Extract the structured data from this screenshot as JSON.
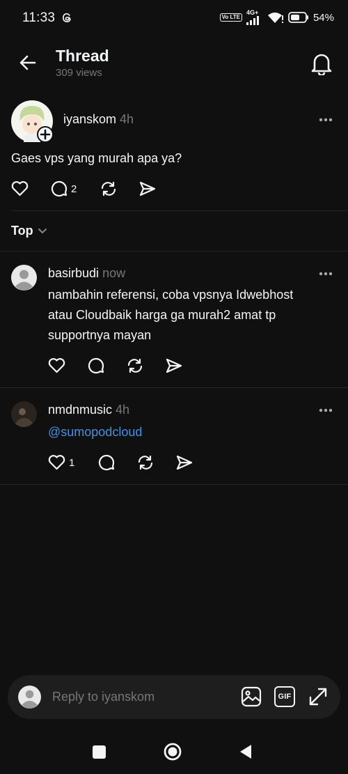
{
  "status_bar": {
    "time": "11:33",
    "network": "4G+",
    "volte": "Vo LTE",
    "battery": "54%"
  },
  "header": {
    "title": "Thread",
    "views": "309 views"
  },
  "post": {
    "username": "iyanskom",
    "time": "4h",
    "text": "Gaes vps yang murah apa ya?",
    "reply_count": "2"
  },
  "sort": {
    "label": "Top"
  },
  "replies": [
    {
      "username": "basirbudi",
      "time": "now",
      "lines": [
        "nambahin referensi, coba vpsnya Idwebhost",
        "atau Cloudbaik harga ga murah2 amat tp",
        "supportnya mayan"
      ]
    },
    {
      "username": "nmdnmusic",
      "time": "4h",
      "text": "@sumopodcloud",
      "like_count": "1"
    }
  ],
  "composer": {
    "placeholder": "Reply to iyanskom",
    "gif_label": "GIF"
  },
  "colors": {
    "background": "#101010",
    "text": "#f3f5f7",
    "muted": "#777777",
    "mention": "#4a90e2",
    "divider": "#262626"
  }
}
